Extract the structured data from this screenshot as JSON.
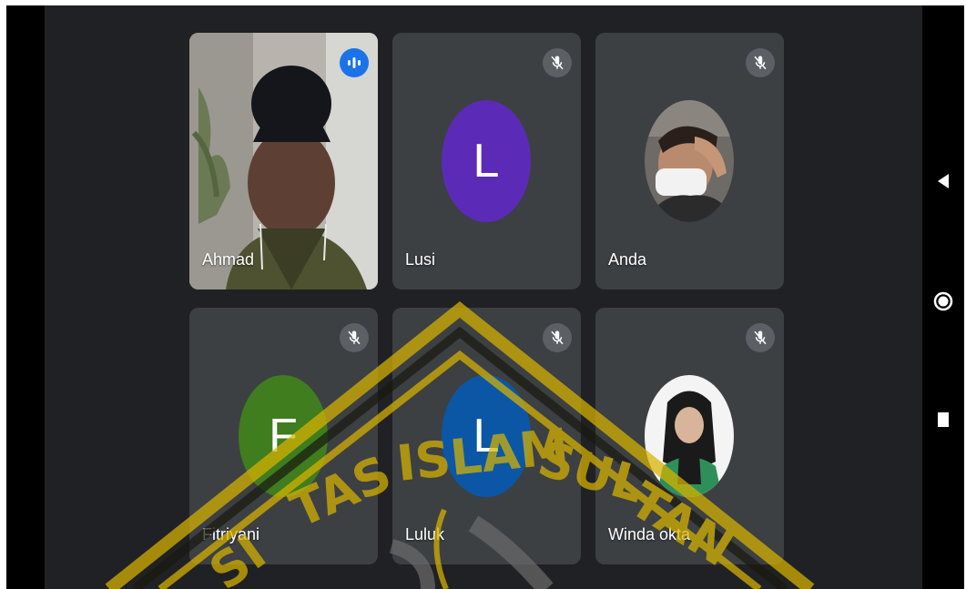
{
  "participants": [
    {
      "name": "Ahmad",
      "status": "speaking",
      "avatar_type": "video"
    },
    {
      "name": "Lusi",
      "initial": "L",
      "color": "#5b2bb8",
      "status": "muted"
    },
    {
      "name": "Anda",
      "status": "muted",
      "avatar_type": "photo"
    },
    {
      "name": "Fitriyani",
      "initial": "F",
      "color": "#3f7d1f",
      "status": "muted"
    },
    {
      "name": "Luluk",
      "initial": "L",
      "color": "#0b57a5",
      "status": "muted"
    },
    {
      "name": "Winda okta",
      "status": "muted",
      "avatar_type": "photo"
    }
  ],
  "icons": {
    "speaking": "audio-bars-icon",
    "muted": "mic-off-icon",
    "nav_back": "triangle-back-icon",
    "nav_home": "circle-home-icon",
    "nav_recents": "square-recents-icon"
  },
  "watermark": {
    "text": "SITAS ISLAM SULTAN",
    "color": "#d9b400"
  },
  "colors": {
    "background": "#202124",
    "tile": "#3c4043",
    "speaking_accent": "#1a73e8"
  }
}
